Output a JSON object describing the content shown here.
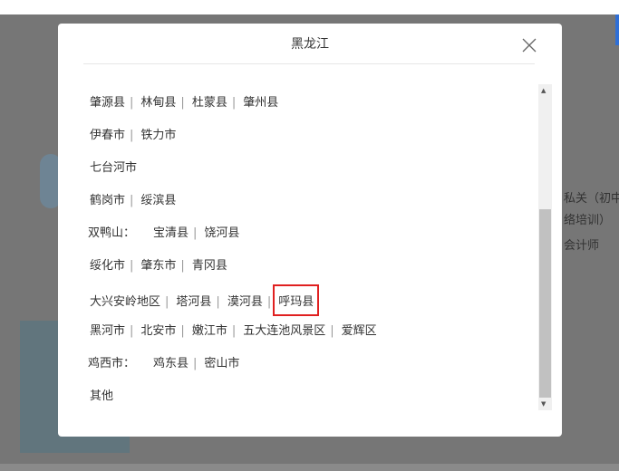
{
  "background": {
    "lines": [
      "私关（初中",
      "络培训）",
      "会计师"
    ]
  },
  "modal": {
    "title": "黑龙江",
    "rows": [
      {
        "lead": null,
        "items": [
          "肇源县",
          "林甸县",
          "杜蒙县",
          "肇州县"
        ]
      },
      {
        "lead": null,
        "items": [
          "伊春市",
          "铁力市"
        ]
      },
      {
        "lead": null,
        "items": [
          "七台河市"
        ]
      },
      {
        "lead": null,
        "items": [
          "鹤岗市",
          "绥滨县"
        ]
      },
      {
        "lead": "双鸭山：",
        "items": [
          "宝清县",
          "饶河县"
        ]
      },
      {
        "lead": null,
        "items": [
          "绥化市",
          "肇东市",
          "青冈县"
        ]
      },
      {
        "lead": null,
        "items": [
          "大兴安岭地区",
          "塔河县",
          "漠河县",
          "呼玛县"
        ],
        "highlight": "呼玛县"
      },
      {
        "lead": null,
        "items": [
          "黑河市",
          "北安市",
          "嫩江市",
          "五大连池风景区",
          "爱辉区"
        ]
      },
      {
        "lead": "鸡西市：",
        "items": [
          "鸡东县",
          "密山市"
        ]
      },
      {
        "lead": null,
        "items": [
          "其他"
        ]
      }
    ],
    "highlight_color": "#e02020"
  }
}
